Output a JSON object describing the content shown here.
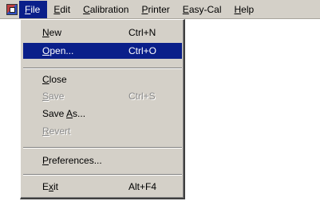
{
  "menubar": {
    "items": [
      {
        "label": "File",
        "mnemonic": "F",
        "rest": "ile"
      },
      {
        "label": "Edit",
        "mnemonic": "E",
        "rest": "dit"
      },
      {
        "label": "Calibration",
        "mnemonic": "C",
        "rest": "alibration"
      },
      {
        "label": "Printer",
        "mnemonic": "P",
        "rest": "rinter"
      },
      {
        "label": "Easy-Cal",
        "mnemonic": "E",
        "rest": "asy-Cal"
      },
      {
        "label": "Help",
        "mnemonic": "H",
        "rest": "elp"
      }
    ]
  },
  "file_menu": {
    "new": {
      "mn": "N",
      "rest": "ew",
      "shortcut": "Ctrl+N"
    },
    "open": {
      "mn": "O",
      "rest": "pen...",
      "shortcut": "Ctrl+O"
    },
    "close": {
      "mn": "C",
      "rest": "lose"
    },
    "save": {
      "mn": "S",
      "rest": "ave",
      "shortcut": "Ctrl+S"
    },
    "save_as": {
      "pre": "Save ",
      "mn": "A",
      "rest": "s..."
    },
    "revert": {
      "mn": "R",
      "rest": "evert"
    },
    "preferences": {
      "mn": "P",
      "rest": "references..."
    },
    "exit": {
      "pre": "E",
      "mn": "x",
      "rest": "it",
      "shortcut": "Alt+F4"
    }
  },
  "colors": {
    "menu_bg": "#d4d0c8",
    "highlight": "#0a1f8a",
    "disabled_text": "#8a8a8a"
  }
}
